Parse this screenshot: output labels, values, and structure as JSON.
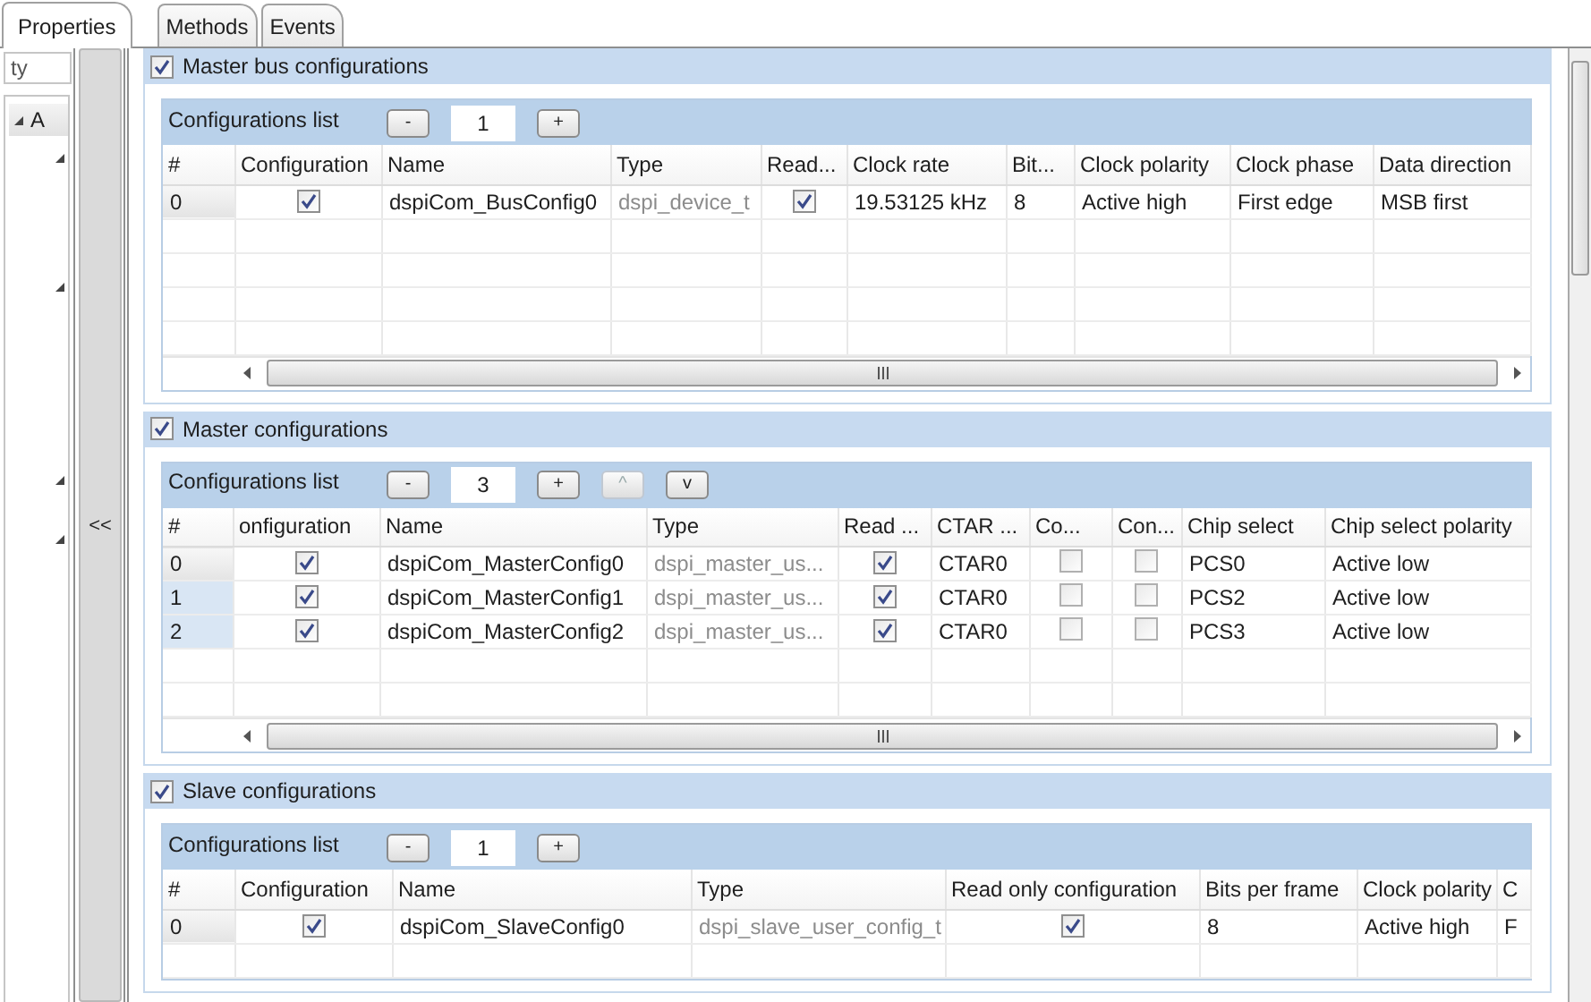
{
  "tabs": [
    {
      "label": "Properties",
      "selected": true
    },
    {
      "label": "Methods",
      "selected": false
    },
    {
      "label": "Events",
      "selected": false
    }
  ],
  "filter": {
    "value": "ty"
  },
  "tree": [
    {
      "label": "A",
      "expanded": true,
      "children": [
        {
          "expanded": true
        },
        {
          "expanded": true
        },
        {
          "expanded": true
        },
        {
          "expanded": true
        }
      ]
    }
  ],
  "collapse_button": "<<",
  "sections": [
    {
      "title": "Master bus configurations",
      "checked": true,
      "list_label": "Configurations list",
      "count": "1",
      "buttons": [
        {
          "label": "-",
          "disabled": false
        },
        {
          "label": "+",
          "disabled": false
        }
      ],
      "columns": [
        {
          "label": "#",
          "kind": "index"
        },
        {
          "label": "Configuration",
          "kind": "check"
        },
        {
          "label": "Name",
          "kind": "text"
        },
        {
          "label": "Type",
          "kind": "muted"
        },
        {
          "label": "Read...",
          "kind": "check"
        },
        {
          "label": "Clock rate",
          "kind": "text"
        },
        {
          "label": "Bit...",
          "kind": "text"
        },
        {
          "label": "Clock polarity",
          "kind": "text"
        },
        {
          "label": "Clock phase",
          "kind": "text"
        },
        {
          "label": "Data direction",
          "kind": "text"
        }
      ],
      "rows": [
        {
          "selected": false,
          "cells": [
            "0",
            {
              "checked": true
            },
            "dspiCom_BusConfig0",
            "dspi_device_t",
            {
              "checked": true
            },
            "19.53125 kHz",
            "8",
            "Active high",
            "First edge",
            "MSB first"
          ]
        }
      ]
    },
    {
      "title": "Master configurations",
      "checked": true,
      "list_label": "Configurations list",
      "count": "3",
      "buttons": [
        {
          "label": "-",
          "disabled": false
        },
        {
          "label": "+",
          "disabled": false
        },
        {
          "label": "^",
          "disabled": true
        },
        {
          "label": "v",
          "disabled": false
        }
      ],
      "columns": [
        {
          "label": "#",
          "kind": "index"
        },
        {
          "label": "onfiguration",
          "kind": "check"
        },
        {
          "label": "Name",
          "kind": "text"
        },
        {
          "label": "Type",
          "kind": "muted"
        },
        {
          "label": "Read ...",
          "kind": "check"
        },
        {
          "label": "CTAR ...",
          "kind": "text"
        },
        {
          "label": "Co...",
          "kind": "check"
        },
        {
          "label": "Con...",
          "kind": "check"
        },
        {
          "label": "Chip select",
          "kind": "text"
        },
        {
          "label": "Chip select polarity",
          "kind": "text"
        }
      ],
      "rows": [
        {
          "selected": false,
          "cells": [
            "0",
            {
              "checked": true
            },
            "dspiCom_MasterConfig0",
            "dspi_master_us...",
            {
              "checked": true
            },
            "CTAR0",
            {
              "checked": false
            },
            {
              "checked": false
            },
            "PCS0",
            "Active low"
          ]
        },
        {
          "selected": true,
          "cells": [
            "1",
            {
              "checked": true
            },
            "dspiCom_MasterConfig1",
            "dspi_master_us...",
            {
              "checked": true
            },
            "CTAR0",
            {
              "checked": false
            },
            {
              "checked": false
            },
            "PCS2",
            "Active low"
          ]
        },
        {
          "selected": true,
          "cells": [
            "2",
            {
              "checked": true
            },
            "dspiCom_MasterConfig2",
            "dspi_master_us...",
            {
              "checked": true
            },
            "CTAR0",
            {
              "checked": false
            },
            {
              "checked": false
            },
            "PCS3",
            "Active low"
          ]
        }
      ]
    },
    {
      "title": "Slave configurations",
      "checked": true,
      "list_label": "Configurations list",
      "count": "1",
      "buttons": [
        {
          "label": "-",
          "disabled": false
        },
        {
          "label": "+",
          "disabled": false
        }
      ],
      "columns": [
        {
          "label": "#",
          "kind": "index"
        },
        {
          "label": "Configuration",
          "kind": "check"
        },
        {
          "label": "Name",
          "kind": "text"
        },
        {
          "label": "Type",
          "kind": "muted"
        },
        {
          "label": "Read only configuration",
          "kind": "check"
        },
        {
          "label": "Bits per frame",
          "kind": "text"
        },
        {
          "label": "Clock polarity",
          "kind": "text"
        },
        {
          "label": "C",
          "kind": "text"
        }
      ],
      "rows": [
        {
          "selected": false,
          "cells": [
            "0",
            {
              "checked": true
            },
            "dspiCom_SlaveConfig0",
            "dspi_slave_user_config_t",
            {
              "checked": true
            },
            "8",
            "Active high",
            "F"
          ]
        }
      ]
    }
  ]
}
